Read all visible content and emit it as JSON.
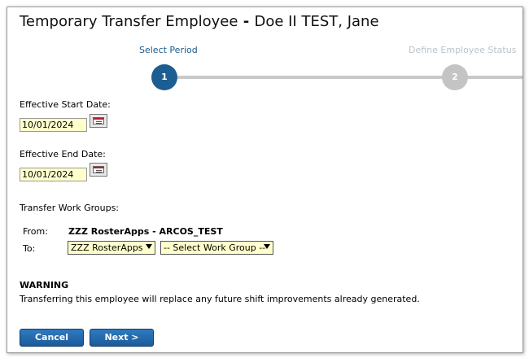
{
  "header": {
    "title_prefix": "Temporary Transfer Employee",
    "title_sep": " - ",
    "title_name": "Doe II TEST, Jane"
  },
  "wizard": {
    "steps": [
      {
        "label": "Select Period",
        "number": "1",
        "state": "active"
      },
      {
        "label": "Define Employee Status",
        "number": "2",
        "state": "inactive"
      }
    ]
  },
  "form": {
    "start_label": "Effective Start Date:",
    "start_value": "10/01/2024",
    "end_label": "Effective End Date:",
    "end_value": "10/01/2024",
    "groups_label": "Transfer Work Groups:",
    "from_label": "From:",
    "from_value": "ZZZ RosterApps - ARCOS_TEST",
    "to_label": "To:",
    "to_company": "ZZZ RosterApps",
    "to_group": "-- Select Work Group --"
  },
  "warning": {
    "title": "WARNING",
    "text": "Transferring this employee will replace any future shift improvements already generated."
  },
  "buttons": {
    "cancel": "Cancel",
    "next": "Next >"
  },
  "icons": {
    "calendar": "calendar-icon",
    "dropdown": "chevron-down-icon"
  },
  "colors": {
    "active_step": "#1c5d92",
    "inactive_step": "#c4c4c4",
    "input_bg": "#ffffcc",
    "button": "#1b5a99"
  }
}
